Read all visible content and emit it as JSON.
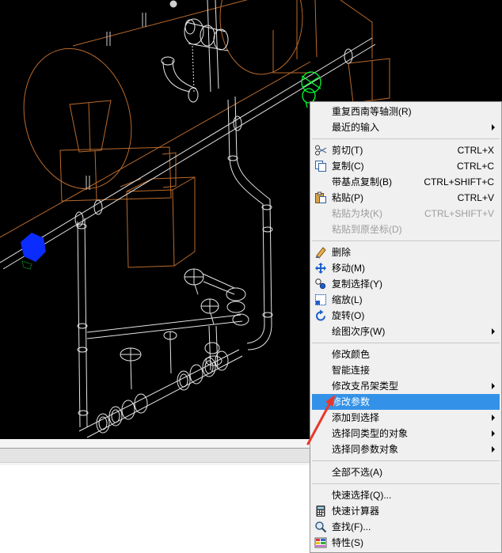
{
  "colors": {
    "canvas_background": "#000000",
    "menu_background": "#f0f0f0",
    "menu_highlight": "#3392e8",
    "disabled_text": "#9d9d9d",
    "annotation_arrow": "#e8382c",
    "drawing_orange": "#b96a2c",
    "drawing_white": "#e6e6e6",
    "selected_green": "#00ff33",
    "selected_blue": "#0a2cff"
  },
  "context_menu": {
    "items": [
      {
        "label": "重复西南等轴测(R)"
      },
      {
        "label": "最近的输入",
        "submenu": true
      },
      {
        "label": "剪切(T)",
        "shortcut": "CTRL+X",
        "icon": "scissors-icon"
      },
      {
        "label": "复制(C)",
        "shortcut": "CTRL+C",
        "icon": "copy-icon"
      },
      {
        "label": "带基点复制(B)",
        "shortcut": "CTRL+SHIFT+C"
      },
      {
        "label": "粘贴(P)",
        "shortcut": "CTRL+V",
        "icon": "paste-icon"
      },
      {
        "label": "粘贴为块(K)",
        "shortcut": "CTRL+SHIFT+V",
        "disabled": true
      },
      {
        "label": "粘贴到原坐标(D)",
        "disabled": true
      },
      {
        "label": "删除",
        "icon": "eraser-icon"
      },
      {
        "label": "移动(M)",
        "icon": "move-icon"
      },
      {
        "label": "复制选择(Y)",
        "icon": "copy-selection-icon"
      },
      {
        "label": "缩放(L)",
        "icon": "scale-icon"
      },
      {
        "label": "旋转(O)",
        "icon": "rotate-icon"
      },
      {
        "label": "绘图次序(W)",
        "submenu": true
      },
      {
        "label": "修改颜色"
      },
      {
        "label": "智能连接"
      },
      {
        "label": "修改支吊架类型",
        "submenu": true
      },
      {
        "label": "修改参数",
        "highlighted": true
      },
      {
        "label": "添加到选择",
        "submenu": true
      },
      {
        "label": "选择同类型的对象",
        "submenu": true
      },
      {
        "label": "选择同参数对象",
        "submenu": true
      },
      {
        "label": "全部不选(A)"
      },
      {
        "label": "快速选择(Q)..."
      },
      {
        "label": "快速计算器",
        "icon": "calculator-icon"
      },
      {
        "label": "查找(F)...",
        "icon": "find-icon"
      },
      {
        "label": "特性(S)",
        "icon": "properties-icon"
      }
    ]
  }
}
